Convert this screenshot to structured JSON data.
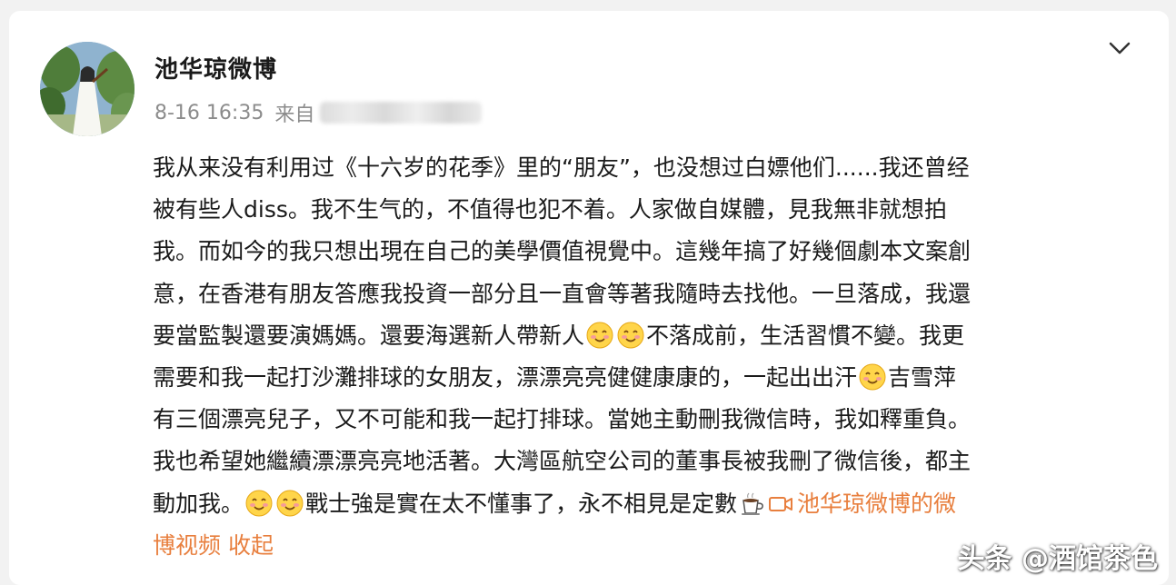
{
  "post": {
    "author": "池华琼微博",
    "time": "8-16 16:35",
    "source_prefix": "来自",
    "text_lines": [
      {
        "before": "我从来没有利用过《十六岁的花季》里的“朋友”，也没想过白嫖他们......我还曾经"
      },
      {
        "before": "被有些人diss。我不生气的，不值得也犯不着。人家做自媒體，見我無非就想拍"
      },
      {
        "before": "我。而如今的我只想出現在自己的美學價值視覺中。這幾年搞了好幾個劇本文案創"
      },
      {
        "before": "意，在香港有朋友答應我投資一部分且一直會等著我隨時去找他。一旦落成，我還"
      },
      {
        "before": "要當監製還要演媽媽。還要海選新人帶新人",
        "after": "不落成前，生活習慣不變。我更"
      },
      {
        "before": "需要和我一起打沙灘排球的女朋友，漂漂亮亮健健康康的，一起出出汗",
        "after": "吉雪萍"
      },
      {
        "before": "有三個漂亮兒子，又不可能和我一起打排球。當她主動刪我微信時，我如釋重負。"
      },
      {
        "before": "我也希望她繼續漂漂亮亮地活著。大灣區航空公司的董事長被我刪了微信後，都主"
      },
      {
        "before": "動加我。",
        "after": "戰士強是實在太不懂事了，永不相見是定數"
      }
    ],
    "video_link": "池华琼微博的微",
    "video_link_cont": "博视频",
    "collapse_label": "收起"
  },
  "emojis": {
    "smile": "smile-emoji",
    "coffee": "coffee-emoji"
  },
  "watermark": "头条 @酒馆茶色",
  "colors": {
    "link": "#e87f3e",
    "text": "#1a1a1a",
    "meta": "#8c8c8c"
  }
}
